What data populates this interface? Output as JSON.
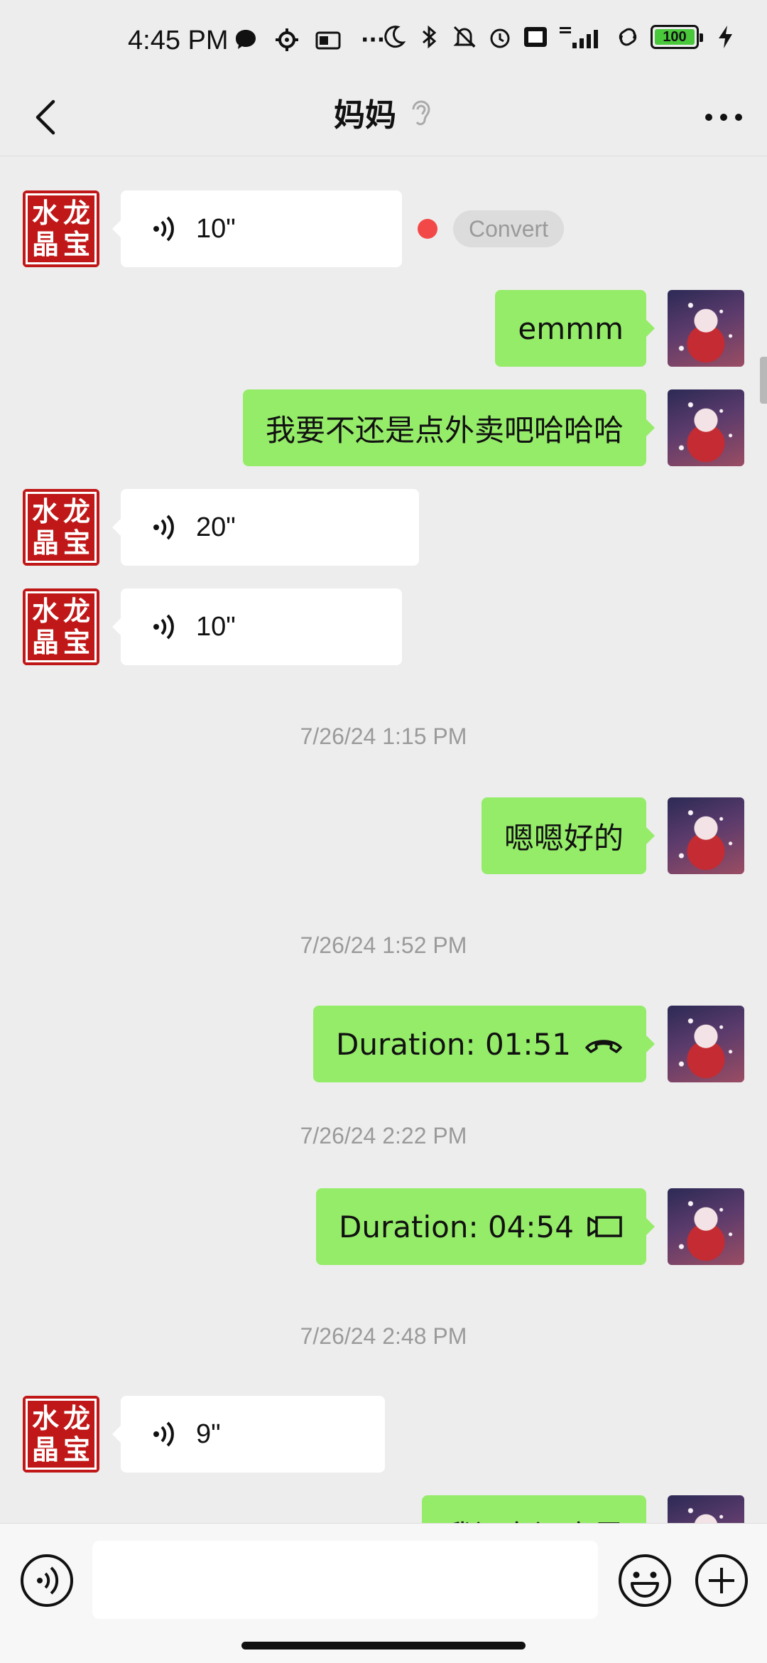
{
  "status_bar": {
    "time": "4:45 PM",
    "more_dots": "···",
    "battery_level": "100"
  },
  "header": {
    "title": "妈妈",
    "back_icon": "chevron-left-icon",
    "mode_icon": "ear-icon",
    "more_icon": "more-horizontal-icon"
  },
  "contact_avatar": {
    "seal_chars": [
      "水",
      "龙",
      "晶",
      "宝"
    ]
  },
  "messages": [
    {
      "type": "voice",
      "direction": "in",
      "duration": "10\"",
      "convert_label": "Convert",
      "unread": true
    },
    {
      "type": "text",
      "direction": "out",
      "text": "emmm"
    },
    {
      "type": "text",
      "direction": "out",
      "text": "我要不还是点外卖吧哈哈哈"
    },
    {
      "type": "voice",
      "direction": "in",
      "duration": "20\""
    },
    {
      "type": "voice",
      "direction": "in",
      "duration": "10\""
    },
    {
      "type": "time",
      "text": "7/26/24 1:15 PM"
    },
    {
      "type": "text",
      "direction": "out",
      "text": "嗯嗯好的"
    },
    {
      "type": "time",
      "text": "7/26/24 1:52 PM"
    },
    {
      "type": "call",
      "direction": "out",
      "text": "Duration: 01:51",
      "call_kind": "voice"
    },
    {
      "type": "time",
      "text": "7/26/24 2:22 PM"
    },
    {
      "type": "call",
      "direction": "out",
      "text": "Duration: 04:54",
      "call_kind": "video"
    },
    {
      "type": "time",
      "text": "7/26/24 2:48 PM"
    },
    {
      "type": "voice",
      "direction": "in",
      "duration": "9\""
    },
    {
      "type": "text",
      "direction": "out",
      "text": "我还在还房里"
    }
  ],
  "input_bar": {
    "voice_icon": "voice-input-icon",
    "emoji_icon": "emoji-icon",
    "plus_icon": "plus-icon",
    "text_value": ""
  },
  "colors": {
    "background": "#ededed",
    "bubble_out": "#95ec69",
    "bubble_in": "#ffffff",
    "unread_dot": "#f34848",
    "battery_fill": "#49c83c"
  }
}
